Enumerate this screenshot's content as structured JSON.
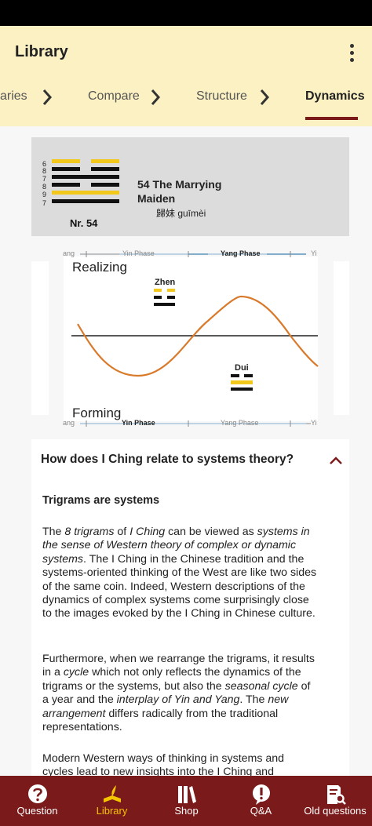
{
  "app": {
    "title": "Library"
  },
  "tabs": [
    {
      "label": "aries",
      "active": false
    },
    {
      "label": "Compare",
      "active": false
    },
    {
      "label": "Structure",
      "active": false
    },
    {
      "label": "Dynamics",
      "active": true
    }
  ],
  "hexagram": {
    "title": "54 The Marrying Maiden",
    "chinese": "歸妹 guīmèi",
    "number_label": "Nr. 54",
    "line_numbers": [
      "6",
      "8",
      "7",
      "8",
      "9",
      "7"
    ]
  },
  "diagram": {
    "top_axis": {
      "left": "ang",
      "phase1": "Yin Phase",
      "phase2": "Yang Phase",
      "right": "Yi"
    },
    "bottom_axis": {
      "left": "ang",
      "phase1": "Yin Phase",
      "phase2": "Yang Phase",
      "right": "Yi"
    },
    "label_top": "Realizing",
    "label_bottom": "Forming",
    "trigram_upper": "Zhen",
    "trigram_lower": "Dui",
    "curve_color": "#d97a2b",
    "yellow": "#f2c81c"
  },
  "faq": {
    "question": "How does I Ching relate to systems theory?",
    "subheading": "Trigrams are systems"
  },
  "bottom_nav": [
    {
      "label": "Question",
      "icon": "question-icon",
      "active": false
    },
    {
      "label": "Library",
      "icon": "library-icon",
      "active": true
    },
    {
      "label": "Shop",
      "icon": "shop-icon",
      "active": false
    },
    {
      "label": "Q&A",
      "icon": "qa-icon",
      "active": false
    },
    {
      "label": "Old questions",
      "icon": "old-questions-icon",
      "active": false
    }
  ],
  "colors": {
    "header_bg": "#fbf1c3",
    "accent": "#7a1a1a",
    "active_nav": "#f5c400"
  }
}
